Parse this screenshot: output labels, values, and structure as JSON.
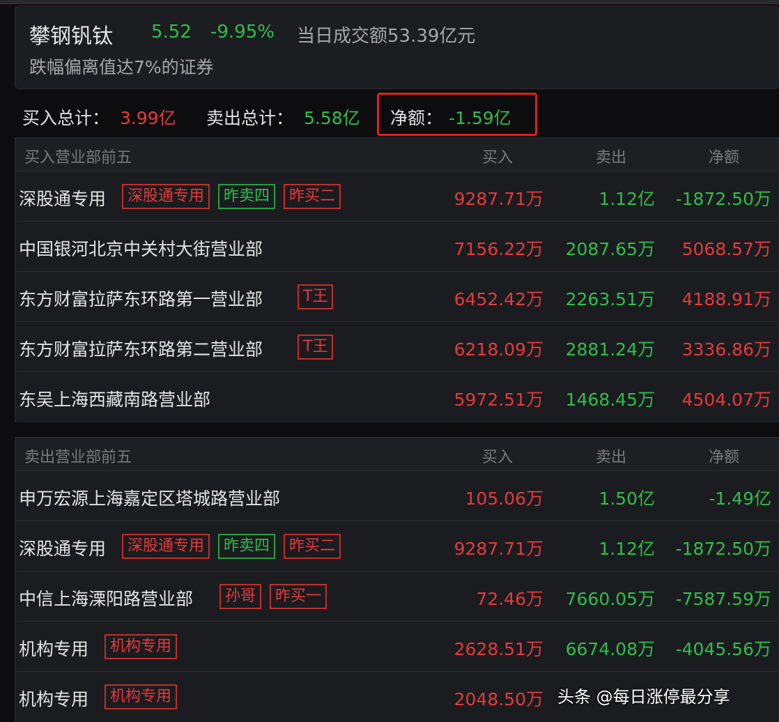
{
  "stock": {
    "name": "攀钢钒钛",
    "price": "5.52",
    "change": "-9.95%",
    "turnover": "当日成交额53.39亿元",
    "reason": "跌幅偏离值达7%的证券"
  },
  "summary": {
    "buy_label": "买入总计：",
    "buy_value": "3.99亿",
    "sell_label": "卖出总计：",
    "sell_value": "5.58亿",
    "net_label": "净额：",
    "net_value": "-1.59亿"
  },
  "buy_section": {
    "title": "买入营业部前五",
    "col_buy": "买入",
    "col_sell": "卖出",
    "col_net": "净额",
    "rows": [
      {
        "name": "深股通专用",
        "tags": [
          {
            "text": "深股通专用",
            "color": "red"
          },
          {
            "text": "昨卖四",
            "color": "green"
          },
          {
            "text": "昨买二",
            "color": "red"
          }
        ],
        "buy": "9287.71万",
        "sell": "1.12亿",
        "net": "-1872.50万",
        "net_color": "green"
      },
      {
        "name": "中国银河北京中关村大街营业部",
        "tags": [],
        "buy": "7156.22万",
        "sell": "2087.65万",
        "net": "5068.57万",
        "net_color": "red"
      },
      {
        "name": "东方财富拉萨东环路第一营业部",
        "tags": [
          {
            "text": "T王",
            "color": "red"
          }
        ],
        "buy": "6452.42万",
        "sell": "2263.51万",
        "net": "4188.91万",
        "net_color": "red"
      },
      {
        "name": "东方财富拉萨东环路第二营业部",
        "tags": [
          {
            "text": "T王",
            "color": "red"
          }
        ],
        "buy": "6218.09万",
        "sell": "2881.24万",
        "net": "3336.86万",
        "net_color": "red"
      },
      {
        "name": "东吴上海西藏南路营业部",
        "tags": [],
        "buy": "5972.51万",
        "sell": "1468.45万",
        "net": "4504.07万",
        "net_color": "red"
      }
    ]
  },
  "sell_section": {
    "title": "卖出营业部前五",
    "col_buy": "买入",
    "col_sell": "卖出",
    "col_net": "净额",
    "rows": [
      {
        "name": "申万宏源上海嘉定区塔城路营业部",
        "tags": [],
        "buy": "105.06万",
        "sell": "1.50亿",
        "net": "-1.49亿",
        "net_color": "green"
      },
      {
        "name": "深股通专用",
        "tags": [
          {
            "text": "深股通专用",
            "color": "red"
          },
          {
            "text": "昨卖四",
            "color": "green"
          },
          {
            "text": "昨买二",
            "color": "red"
          }
        ],
        "buy": "9287.71万",
        "sell": "1.12亿",
        "net": "-1872.50万",
        "net_color": "green"
      },
      {
        "name": "中信上海溧阳路营业部",
        "tags": [
          {
            "text": "孙哥",
            "color": "red"
          },
          {
            "text": "昨买一",
            "color": "red"
          }
        ],
        "buy": "72.46万",
        "sell": "7660.05万",
        "net": "-7587.59万",
        "net_color": "green"
      },
      {
        "name": "机构专用",
        "tags": [
          {
            "text": "机构专用",
            "color": "red"
          }
        ],
        "buy": "2628.51万",
        "sell": "6674.08万",
        "net": "-4045.56万",
        "net_color": "green"
      },
      {
        "name": "机构专用",
        "tags": [
          {
            "text": "机构专用",
            "color": "red"
          }
        ],
        "buy": "2048.50万",
        "sell": "",
        "net": "",
        "net_color": "green"
      }
    ]
  },
  "watermark": "头条 @每日涨停最分享",
  "colors": {
    "up": "#e53a3a",
    "down": "#2fbf4a",
    "highlight_box": "#e0201b"
  }
}
